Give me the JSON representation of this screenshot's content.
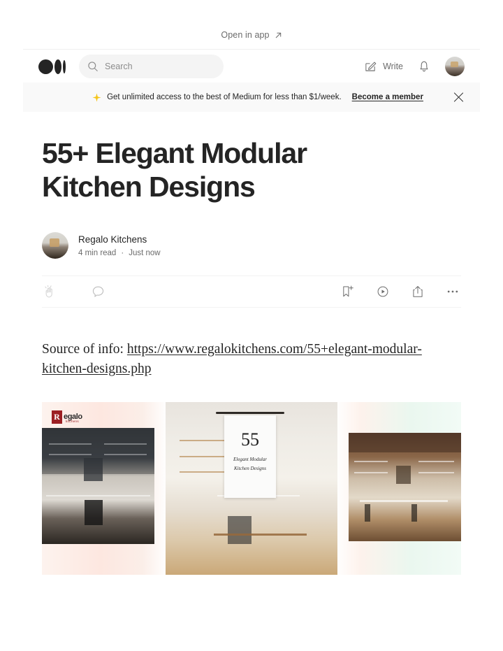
{
  "topbar": {
    "open_in_app": "Open in app",
    "arrow_icon": "arrow-up-right-icon"
  },
  "nav": {
    "logo_icon": "medium-logo-icon",
    "search": {
      "placeholder": "Search",
      "value": "",
      "icon": "search-icon"
    },
    "write_label": "Write",
    "write_icon": "write-pencil-icon",
    "notifications_icon": "bell-icon",
    "avatar_icon": "user-avatar"
  },
  "promo": {
    "sparkle_icon": "sparkle-icon",
    "text": "Get unlimited access to the best of Medium for less than $1/week.",
    "cta": "Become a member",
    "close_icon": "close-icon",
    "accent_color": "#f5c518",
    "background": "#f9f9f9"
  },
  "article": {
    "title": "55+ Elegant Modular Kitchen Designs",
    "author": {
      "name": "Regalo Kitchens",
      "read_time": "4 min read",
      "separator": "·",
      "published": "Just now",
      "avatar_icon": "author-avatar"
    },
    "actions": {
      "clap_icon": "clap-icon",
      "comment_icon": "comment-icon",
      "bookmark_icon": "bookmark-add-icon",
      "listen_icon": "play-listen-icon",
      "share_icon": "share-icon",
      "more_icon": "more-options-icon"
    },
    "body": {
      "prefix": "Source of info: ",
      "link_text": "https://www.regalokitchens.com/55+elegant-modular-kitchen-designs.php"
    }
  },
  "collage": {
    "alt": "three-panel modular kitchen collage",
    "brand_badge": "R",
    "brand_word": "egalo",
    "brand_sub": "kitchens",
    "brand_color": "#9c1f23",
    "poster_number": "55",
    "poster_line1": "Elegant Modular",
    "poster_line2": "Kitchen Designs"
  }
}
